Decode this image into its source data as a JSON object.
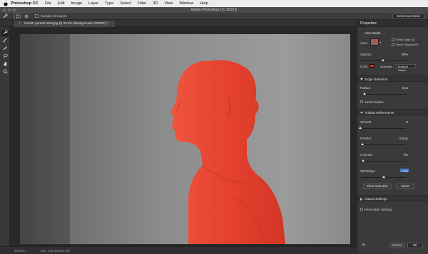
{
  "menubar": {
    "app": "Photoshop CC",
    "items": [
      "File",
      "Edit",
      "Image",
      "Layer",
      "Type",
      "Select",
      "Filter",
      "3D",
      "View",
      "Window",
      "Help"
    ]
  },
  "titlebar": {
    "title": "Adobe Photoshop CC 2015.5"
  },
  "options": {
    "sample_all_layers": "Sample All Layers",
    "select_and_mask": "Select and Mask"
  },
  "document": {
    "tab_label": "CandC portrait start.jpg @ 33.3% (Background, RGB/8*) *",
    "close_glyph": "×"
  },
  "status": {
    "zoom": "33.33%",
    "doc_size": "Doc: 104.4M/104.4M"
  },
  "panel": {
    "title": "Properties",
    "view_mode": {
      "heading": "View Mode",
      "view_label": "View:",
      "show_edge": "Show Edge (J)",
      "show_original": "Show Original (P)"
    },
    "opacity": {
      "label": "Opacity:",
      "value": "50%",
      "level": 0.5
    },
    "color": {
      "label": "Color:",
      "swatch": "#e02b20",
      "indicates_label": "Indicates:",
      "indicates_value": "Masked Areas"
    },
    "edge_detection": {
      "heading": "Edge Detection",
      "radius": {
        "label": "Radius:",
        "value": "3 px",
        "level": 0.1
      },
      "smart_radius": "Smart Radius"
    },
    "global_refinements": {
      "heading": "Global Refinements",
      "smooth": {
        "label": "Smooth:",
        "value": "0",
        "level": 0.0
      },
      "feather": {
        "label": "Feather:",
        "value": "0.5 px",
        "level": 0.05
      },
      "contrast": {
        "label": "Contrast:",
        "value": "5%",
        "level": 0.06
      },
      "shift_edge": {
        "label": "Shift Edge:",
        "value": "+2%",
        "level": 0.52
      }
    },
    "buttons": {
      "clear_selection": "Clear Selection",
      "invert": "Invert"
    },
    "output_settings": "Output Settings",
    "remember_settings": "Remember Settings",
    "cancel": "Cancel",
    "ok": "OK"
  },
  "colors": {
    "overlay": "#e9402f",
    "accent": "#4a7bd0"
  }
}
